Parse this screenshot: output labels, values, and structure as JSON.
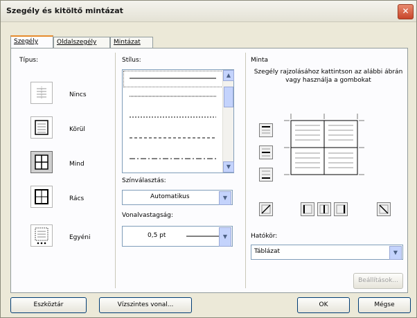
{
  "window": {
    "title": "Szegély és kitöltő mintázat",
    "close": "✕"
  },
  "tabs": [
    {
      "label": "Szegély",
      "active": true
    },
    {
      "label": "Oldalszegély",
      "active": false
    },
    {
      "label": "Mintázat",
      "active": false
    }
  ],
  "type": {
    "label": "Típus:",
    "options": [
      {
        "label": "Nincs",
        "icon": "border-none-icon",
        "selected": false
      },
      {
        "label": "Körül",
        "icon": "border-box-icon",
        "selected": false
      },
      {
        "label": "Mind",
        "icon": "border-all-icon",
        "selected": true
      },
      {
        "label": "Rács",
        "icon": "border-grid-icon",
        "selected": false
      },
      {
        "label": "Egyéni",
        "icon": "border-custom-icon",
        "selected": false
      }
    ]
  },
  "style": {
    "label": "Stílus:",
    "color_label": "Színválasztás:",
    "color_value": "Automatikus",
    "width_label": "Vonalvastagság:",
    "width_value": "0,5 pt"
  },
  "preview": {
    "label": "Minta",
    "hint": "Szegély rajzolásához kattintson az alábbi ábrán vagy használja a gombokat",
    "scope_label": "Hatókör:",
    "scope_value": "Táblázat",
    "options_button": "Beállítások..."
  },
  "footer": {
    "toolbar_button": "Eszköztár",
    "hline_button": "Vízszintes vonal...",
    "ok_button": "OK",
    "cancel_button": "Mégse"
  }
}
